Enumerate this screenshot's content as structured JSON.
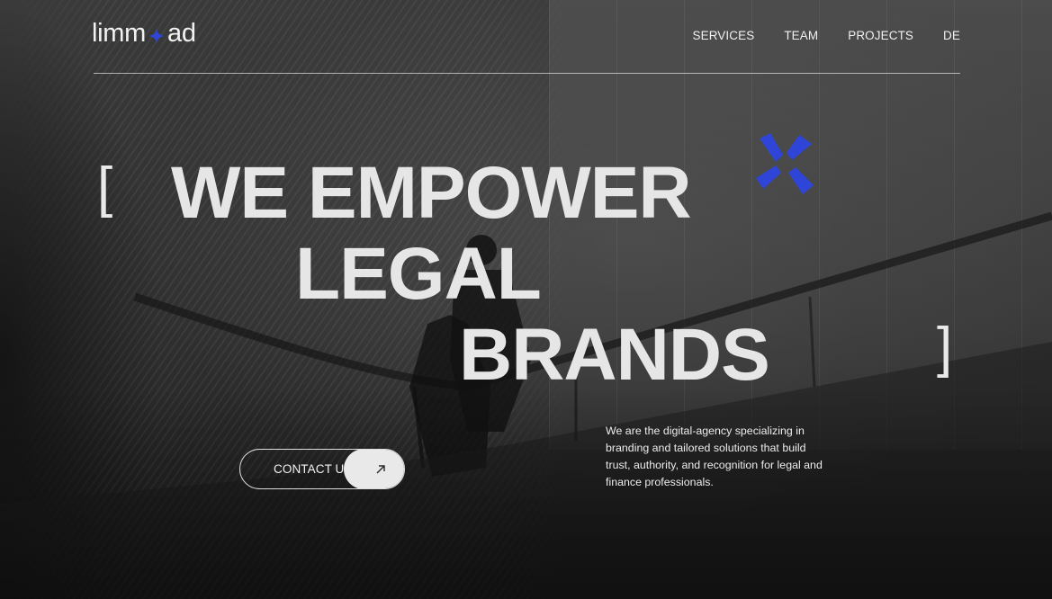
{
  "header": {
    "logo_left": "limm",
    "logo_right": "ad",
    "nav": [
      {
        "label": "SERVICES"
      },
      {
        "label": "TEAM"
      },
      {
        "label": "PROJECTS"
      },
      {
        "label": "DE"
      }
    ]
  },
  "hero": {
    "bracket_open": "[",
    "bracket_close": "]",
    "headline": [
      "WE EMPOWER",
      "LEGAL",
      "BRANDS"
    ],
    "cta_label": "CONTACT US",
    "description": "We are the digital-agency specializing in branding and tailored solutions that build trust, authority, and recognition for legal and finance professionals."
  },
  "colors": {
    "accent": "#2f45d8",
    "text": "#e6e6e6",
    "background": "#2b2b2b"
  },
  "icons": {
    "logo_mark": "plus-sparkle-icon",
    "decoration": "blue-x-icon",
    "cta_arrow": "arrow-up-right-icon"
  }
}
